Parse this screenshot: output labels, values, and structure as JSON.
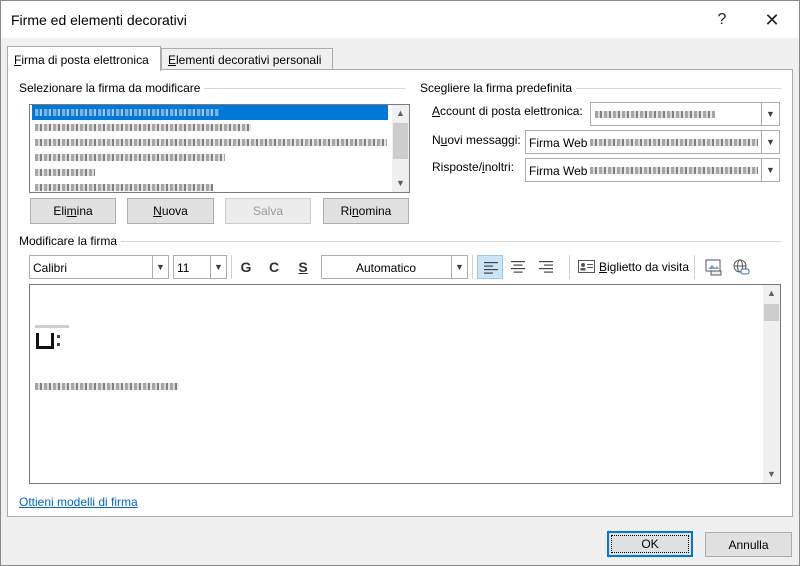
{
  "window": {
    "title": "Firme ed elementi decorativi",
    "help_glyph": "?",
    "close_glyph": "✕"
  },
  "tabs": [
    {
      "label_prefix": "",
      "label_key": "F",
      "label_rest": "irma di posta elettronica",
      "active": true
    },
    {
      "label_prefix": "",
      "label_key": "E",
      "label_rest": "lementi decorativi personali",
      "active": false
    }
  ],
  "select_section": {
    "title": "Selezionare la firma da modificare"
  },
  "signature_list": {
    "item_count": 6,
    "selected_index": 0
  },
  "list_buttons": {
    "delete": {
      "pre": "Eli",
      "key": "m",
      "post": "ina"
    },
    "new": {
      "pre": "",
      "key": "N",
      "post": "uova"
    },
    "save": {
      "pre": "Salva",
      "key": "",
      "post": ""
    },
    "rename": {
      "pre": "Ri",
      "key": "n",
      "post": "omina"
    }
  },
  "default_section": {
    "title": "Scegliere la firma predefinita",
    "account_label": {
      "pre": "",
      "key": "A",
      "post": "ccount di posta elettronica:"
    },
    "new_messages_label": {
      "pre": "N",
      "key": "u",
      "post": "ovi messaggi:"
    },
    "replies_label": {
      "pre": "Risposte/",
      "key": "i",
      "post": "noltri:"
    },
    "new_messages_value": "Firma Web",
    "replies_value": "Firma Web"
  },
  "edit_section": {
    "title": "Modificare la firma"
  },
  "toolbar": {
    "font": "Calibri",
    "size": "11",
    "bold": "G",
    "italic": "C",
    "underline": "S",
    "color": "Automatico",
    "business_card": {
      "pre": "",
      "key": "B",
      "post": "iglietto da visita"
    }
  },
  "footer": {
    "templates_link": "Ottieni modelli di firma",
    "ok_label": "OK",
    "cancel_label": "Annulla"
  },
  "colors": {
    "accent": "#0078d7",
    "link": "#0066cc"
  }
}
